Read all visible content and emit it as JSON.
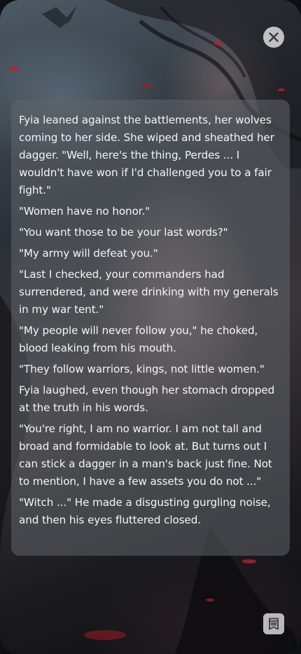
{
  "icons": {
    "close": "close-icon",
    "menu": "book-menu-icon"
  },
  "colors": {
    "panel": "#60646a",
    "text": "#f5f5f5",
    "button": "#dcdcde"
  },
  "story": {
    "paragraphs": [
      "Fyia leaned against the battlements, her wolves coming to her side. She wiped and sheathed her dagger. \"Well, here's the thing, Perdes ... I wouldn't have won if I'd challenged you to a fair fight.\"",
      "\"Women have no honor.\"",
      "\"You want those to be your last words?\"",
      "\"My army will defeat you.\"",
      "\"Last I checked, your commanders had surrendered, and were drinking with my generals in my war tent.\"",
      "\"My people will never follow you,\" he choked, blood leaking from his mouth.",
      "\"They follow warriors, kings, not little women.\"",
      "Fyia laughed, even though her stomach dropped at the truth in his words.",
      "\"You're right, I am no warrior. I am not tall and broad and formidable to look at. But turns out I can stick a dagger in a man's back just fine. Not to mention, I have a few assets you do not ...\"",
      "\"Witch ...\" He made a disgusting gurgling noise, and then his eyes fluttered closed."
    ]
  }
}
